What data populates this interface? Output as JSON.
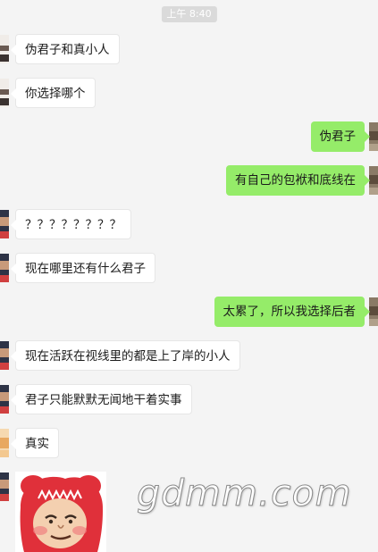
{
  "time_label": "上午 8:40",
  "colors": {
    "background": "#f4f4f4",
    "incoming_bubble": "#ffffff",
    "outgoing_bubble": "#95ec69"
  },
  "messages": [
    {
      "side": "in",
      "text": "伪君子和真小人"
    },
    {
      "side": "in",
      "text": "你选择哪个"
    },
    {
      "side": "out",
      "text": "伪君子"
    },
    {
      "side": "out",
      "text": "有自己的包袱和底线在"
    },
    {
      "side": "in",
      "text": "？？？？？？？？"
    },
    {
      "side": "in",
      "text": "现在哪里还有什么君子"
    },
    {
      "side": "out",
      "text": "太累了，所以我选择后者"
    },
    {
      "side": "in",
      "text": "现在活跃在视线里的都是上了岸的小人"
    },
    {
      "side": "in",
      "text": "君子只能默默无闻地干着实事"
    },
    {
      "side": "in",
      "text": "真实"
    }
  ],
  "sticker": {
    "icon": "meme-face-sticker-icon"
  },
  "watermark": {
    "text": "gdmm.com"
  }
}
